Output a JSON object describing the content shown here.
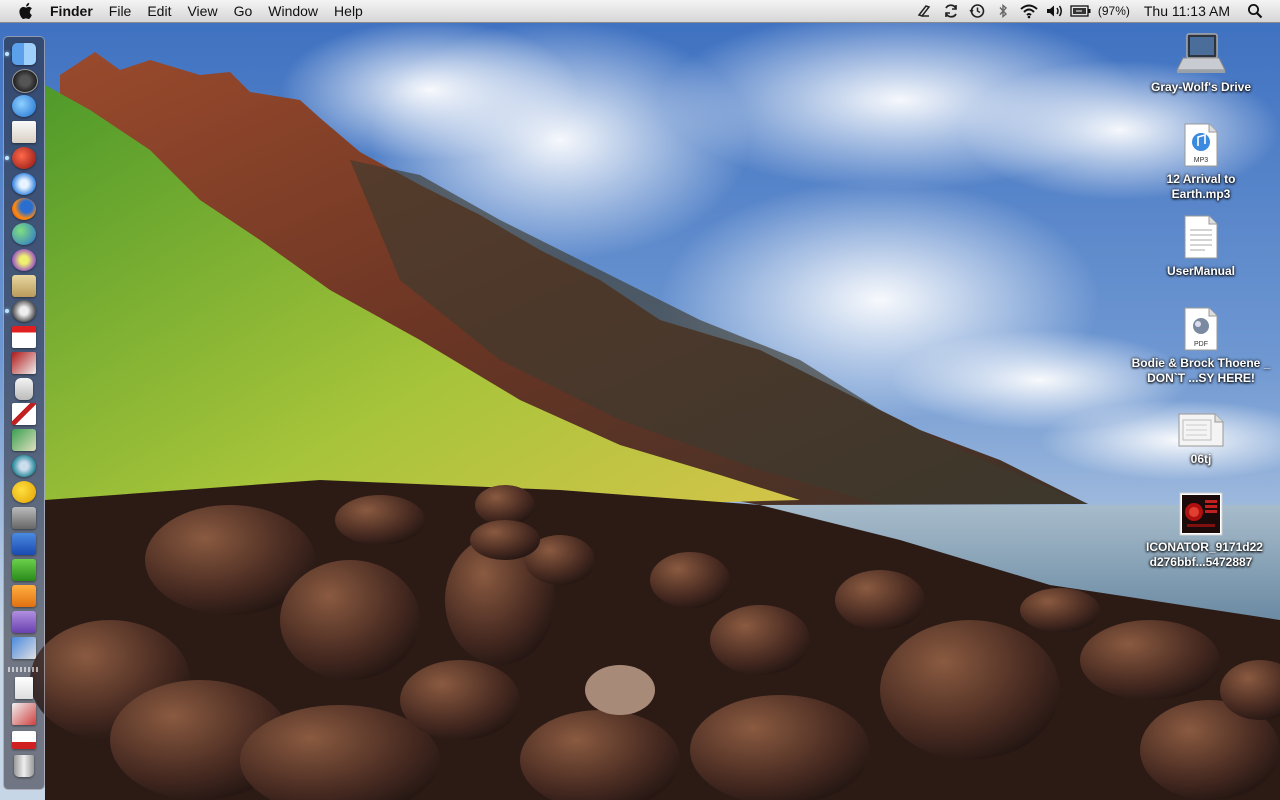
{
  "menubar": {
    "apple_icon": "apple-icon",
    "app_name": "Finder",
    "menus": [
      "File",
      "Edit",
      "View",
      "Go",
      "Window",
      "Help"
    ],
    "status_icons": [
      "script-icon",
      "sync-icon",
      "time-machine-icon",
      "bluetooth-icon",
      "wifi-icon",
      "volume-icon",
      "battery-icon"
    ],
    "battery_percent": "(97%)",
    "clock": "Thu 11:13 AM",
    "spotlight_icon": "spotlight-icon"
  },
  "desktop": {
    "items": [
      {
        "label": "Gray-Wolf's Drive",
        "icon": "hard-drive-icon"
      },
      {
        "label": "12 Arrival to Earth.mp3",
        "icon": "mp3-file-icon"
      },
      {
        "label": "UserManual",
        "icon": "document-icon"
      },
      {
        "label": "Bodie & Brock Thoene _ DON`T ...SY HERE!",
        "icon": "pdf-file-icon"
      },
      {
        "label": "06tj",
        "icon": "image-file-icon"
      },
      {
        "label": "ICONATOR_9171d22 d276bbf...5472887",
        "icon": "poster-image-icon"
      }
    ]
  },
  "dock": {
    "apps": [
      "finder-icon",
      "dashboard-icon",
      "mail-icon",
      "preview-icon",
      "front-row-icon",
      "safari-icon",
      "firefox-icon",
      "ichat-icon",
      "itunes-icon",
      "address-book-icon",
      "system-preferences-icon",
      "calendar-icon",
      "book-icon",
      "remote-icon",
      "cards-game-icon",
      "map-icon",
      "time-machine-icon",
      "messenger-icon",
      "utility-icon",
      "word-icon",
      "app-x-icon",
      "app-p-icon",
      "app-e-icon",
      "photo-icon"
    ],
    "stacks": [
      "documents-stack-icon",
      "downloads-stack-icon",
      "mail-stack-icon",
      "trash-icon"
    ]
  },
  "colors": {
    "menubar_top": "#f4f4f4",
    "menubar_bottom": "#d6d6d6",
    "sky": "#5a86c8",
    "ocean": "#8aa9bf",
    "rocks": "#3a2620",
    "cliff": "#8a3a22",
    "grass": "#7fb636"
  }
}
